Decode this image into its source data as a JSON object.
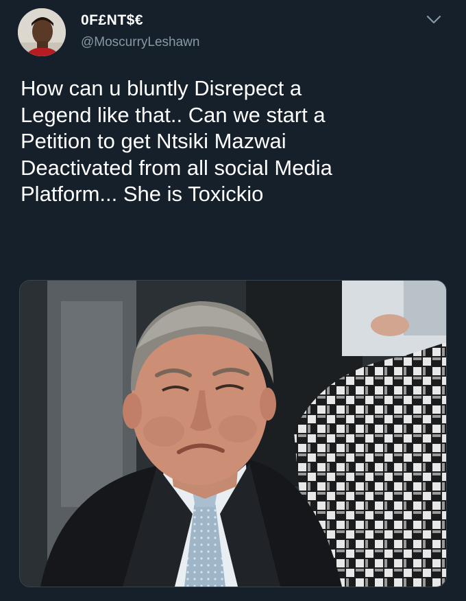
{
  "tweet": {
    "display_name": "0F£NT$€",
    "handle": "@MoscurryLeshawn",
    "text": "How can u bluntly Disrepect a\nLegend like that.. Can we start a\nPetition to get Ntsiki Mazwai\nDeactivated from all social Media\nPlatform... She is Toxickio"
  },
  "icons": {
    "menu": "chevron-down-icon"
  },
  "colors": {
    "background": "#15202b",
    "text_primary": "#ffffff",
    "text_secondary": "#8899a6"
  }
}
